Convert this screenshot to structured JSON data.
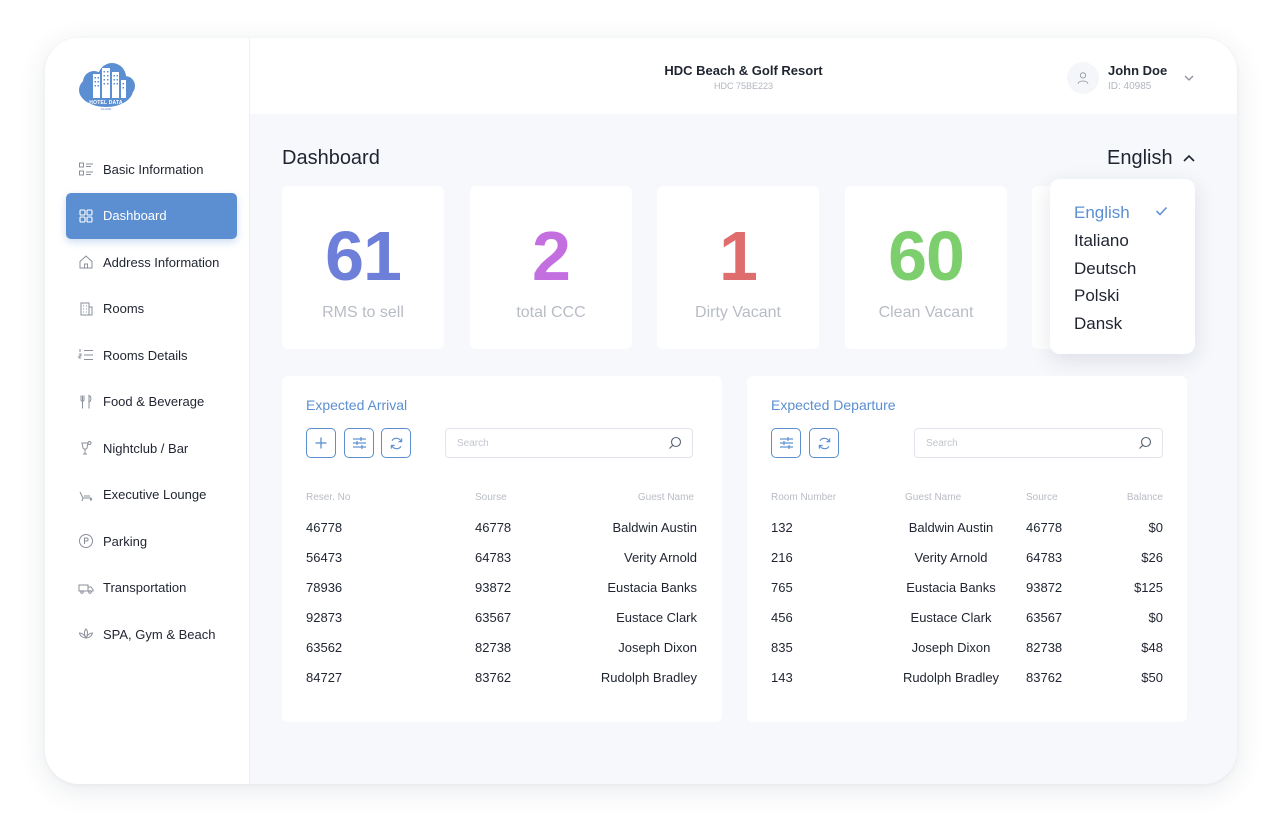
{
  "brand": {
    "logo_text": "HOTEL DATA",
    "logo_subtext": "CLOUD"
  },
  "hotel": {
    "name": "HDC Beach & Golf Resort",
    "id": "HDC 75BE223"
  },
  "user": {
    "name": "John Doe",
    "id": "ID: 40985"
  },
  "sidebar": {
    "items": [
      {
        "label": "Basic Information",
        "icon": "list-icon"
      },
      {
        "label": "Dashboard",
        "icon": "grid-icon",
        "active": true
      },
      {
        "label": "Address Information",
        "icon": "home-icon"
      },
      {
        "label": "Rooms",
        "icon": "building-icon"
      },
      {
        "label": "Rooms Details",
        "icon": "numbered-list-icon"
      },
      {
        "label": "Food & Beverage",
        "icon": "cutlery-icon"
      },
      {
        "label": "Nightclub / Bar",
        "icon": "cocktail-icon"
      },
      {
        "label": "Executive Lounge",
        "icon": "lounge-chair-icon"
      },
      {
        "label": "Parking",
        "icon": "parking-icon"
      },
      {
        "label": "Transportation",
        "icon": "truck-icon"
      },
      {
        "label": "SPA, Gym & Beach",
        "icon": "lotus-icon"
      }
    ]
  },
  "page": {
    "title": "Dashboard"
  },
  "language": {
    "current": "English",
    "options": [
      "English",
      "Italiano",
      "Deutsch",
      "Polski",
      "Dansk"
    ]
  },
  "stats": [
    {
      "value": "61",
      "label": "RMS to sell",
      "color": "#6d7fd9"
    },
    {
      "value": "2",
      "label": "total CCC",
      "color": "#c46fe0"
    },
    {
      "value": "1",
      "label": "Dirty Vacant",
      "color": "#e06d6d"
    },
    {
      "value": "60",
      "label": "Clean Vacant",
      "color": "#7ccf6c"
    }
  ],
  "arrival": {
    "title": "Expected Arrival",
    "search_placeholder": "Search",
    "columns": [
      "Reser. No",
      "Sourse",
      "Guest Name"
    ],
    "rows": [
      [
        "46778",
        "46778",
        "Baldwin Austin"
      ],
      [
        "56473",
        "64783",
        "Verity Arnold"
      ],
      [
        "78936",
        "93872",
        "Eustacia Banks"
      ],
      [
        "92873",
        "63567",
        "Eustace Clark"
      ],
      [
        "63562",
        "82738",
        "Joseph Dixon"
      ],
      [
        "84727",
        "83762",
        "Rudolph Bradley"
      ]
    ]
  },
  "departure": {
    "title": "Expected Departure",
    "search_placeholder": "Search",
    "columns": [
      "Room Number",
      "Guest Name",
      "Source",
      "Balance"
    ],
    "rows": [
      [
        "132",
        "Baldwin Austin",
        "46778",
        "$0"
      ],
      [
        "216",
        "Verity Arnold",
        "64783",
        "$26"
      ],
      [
        "765",
        "Eustacia Banks",
        "93872",
        "$125"
      ],
      [
        "456",
        "Eustace Clark",
        "63567",
        "$0"
      ],
      [
        "835",
        "Joseph Dixon",
        "82738",
        "$48"
      ],
      [
        "143",
        "Rudolph Bradley",
        "83762",
        "$50"
      ]
    ]
  },
  "colors": {
    "accent": "#5b8fd1",
    "text": "#1f2430",
    "muted": "#b8bcc4"
  }
}
